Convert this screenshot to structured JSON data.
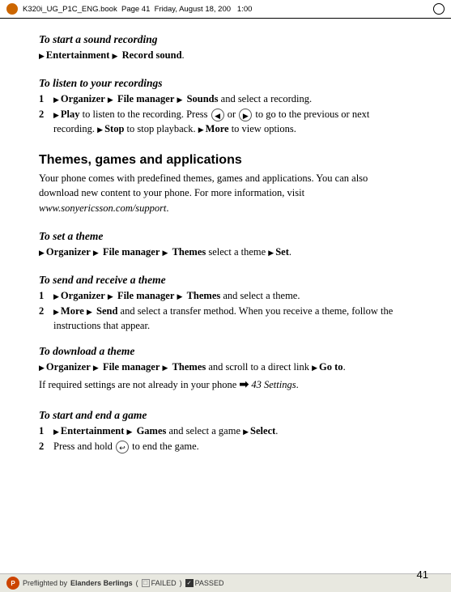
{
  "book_header": {
    "text": "K320i_UG_P1C_ENG.book  Page 41  Friday, August 18, 200   1:00 "
  },
  "page_number": "41",
  "bottom_bar": {
    "preflight_label": "Preflighted by",
    "company": "Elanders Berlings",
    "failed_label": "FAILED",
    "passed_label": "PASSED"
  },
  "sections": [
    {
      "id": "start-sound-recording",
      "heading": "To start a sound recording",
      "items": [
        {
          "type": "body",
          "text": "▶ Entertainment ▶ Record sound."
        }
      ]
    },
    {
      "id": "listen-to-recordings",
      "heading": "To listen to your recordings",
      "items": [
        {
          "type": "numbered",
          "num": "1",
          "text": "▶ Organizer ▶ File manager ▶ Sounds and select a recording."
        },
        {
          "type": "numbered",
          "num": "2",
          "text": "▶ Play to listen to the recording. Press ● or ● to go to the previous or next recording. ▶ Stop to stop playback. ▶ More to view options."
        }
      ]
    },
    {
      "id": "themes-games-apps",
      "heading": "Themes, games and applications",
      "body_paragraphs": [
        "Your phone comes with predefined themes, games and applications. You can also download new content to your phone. For more information, visit www.sonyericsson.com/support."
      ]
    },
    {
      "id": "set-a-theme",
      "heading": "To set a theme",
      "items": [
        {
          "type": "body",
          "text": "▶ Organizer ▶ File manager ▶ Themes select a theme ▶ Set."
        }
      ]
    },
    {
      "id": "send-receive-theme",
      "heading": "To send and receive a theme",
      "items": [
        {
          "type": "numbered",
          "num": "1",
          "text": "▶ Organizer ▶ File manager ▶ Themes and select a theme."
        },
        {
          "type": "numbered",
          "num": "2",
          "text": "▶ More ▶ Send and select a transfer method. When you receive a theme, follow the instructions that appear."
        }
      ]
    },
    {
      "id": "download-a-theme",
      "heading": "To download a theme",
      "items": [
        {
          "type": "body",
          "text": "▶ Organizer ▶ File manager ▶ Themes and scroll to a direct link ▶ Go to."
        },
        {
          "type": "body",
          "text": "If required settings are not already in your phone ➡ 43 Settings."
        }
      ]
    },
    {
      "id": "start-end-game",
      "heading": "To start and end a game",
      "items": [
        {
          "type": "numbered",
          "num": "1",
          "text": "▶ Entertainment ▶ Games and select a game ▶ Select."
        },
        {
          "type": "numbered",
          "num": "2",
          "text": "Press and hold ⬅ to end the game."
        }
      ]
    }
  ]
}
